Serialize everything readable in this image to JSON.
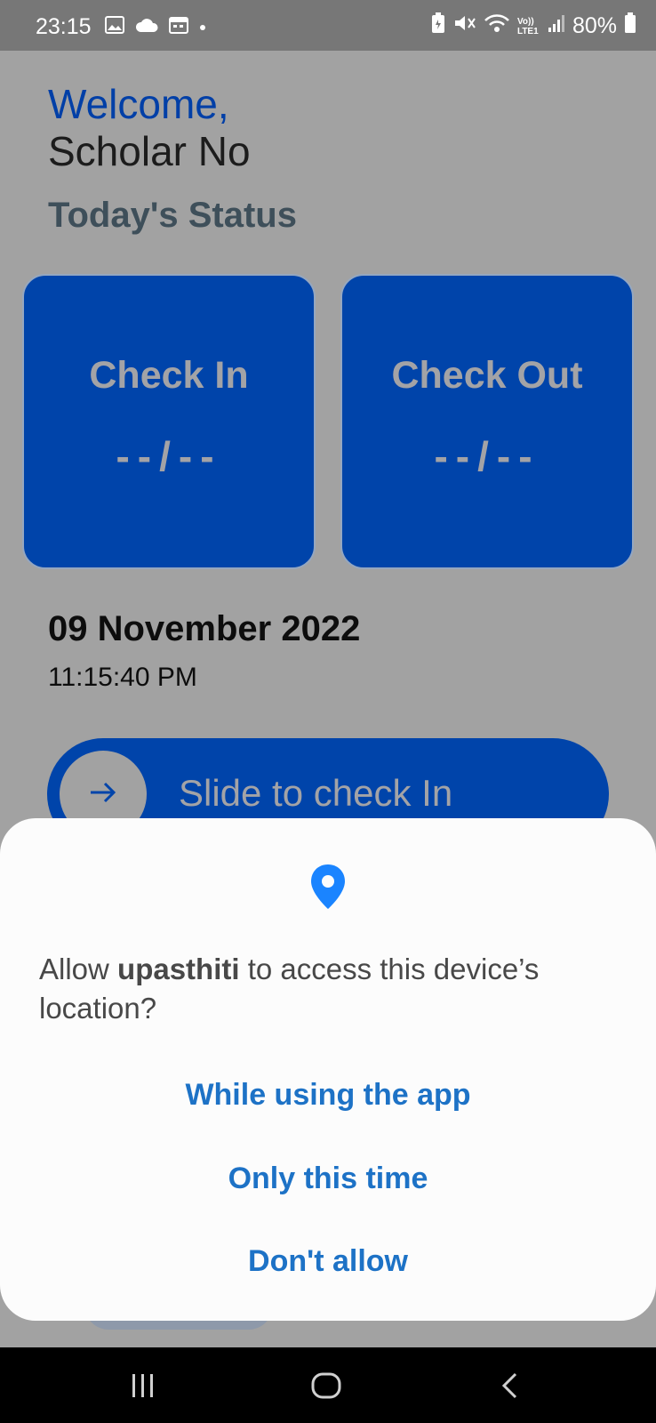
{
  "status_bar": {
    "time": "23:15",
    "battery": "80%",
    "network_label": "Vo)) LTE1"
  },
  "header": {
    "welcome": "Welcome,",
    "user_name": "Scholar No",
    "status_title": "Today's Status"
  },
  "cards": {
    "check_in": {
      "label": "Check In",
      "time": "--/--"
    },
    "check_out": {
      "label": "Check Out",
      "time": "--/--"
    }
  },
  "date": "09 November 2022",
  "time": "11:15:40 PM",
  "slider": {
    "label": "Slide to check In"
  },
  "dialog": {
    "prompt_prefix": "Allow ",
    "app_name": "upasthiti",
    "prompt_suffix": " to access this device’s location?",
    "options": [
      "While using the app",
      "Only this time",
      "Don't allow"
    ]
  },
  "colors": {
    "primary": "#0044aa",
    "dialog_accent": "#1d72c6",
    "pin": "#1a84ff"
  }
}
